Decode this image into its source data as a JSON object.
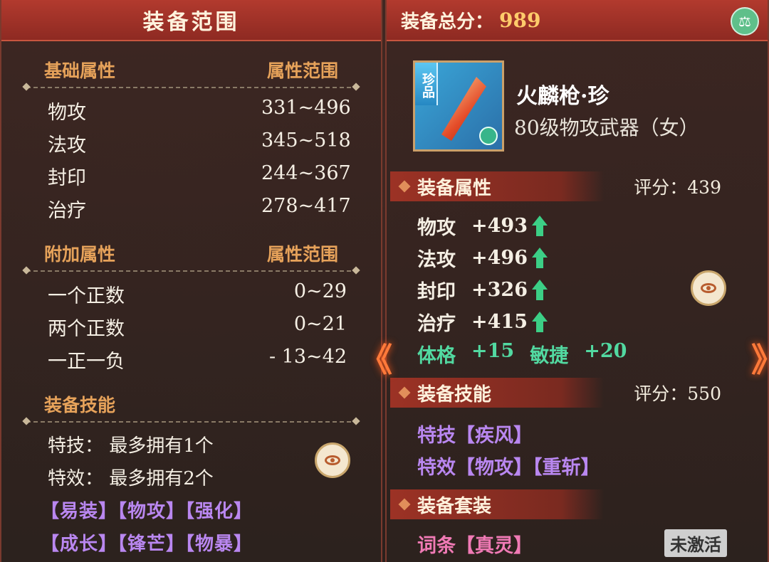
{
  "left": {
    "title": "装备范围",
    "base_section": {
      "label": "基础属性",
      "range_label": "属性范围"
    },
    "base_rows": [
      {
        "name": "物攻",
        "range": "331~496"
      },
      {
        "name": "法攻",
        "range": "345~518"
      },
      {
        "name": "封印",
        "range": "244~367"
      },
      {
        "name": "治疗",
        "range": "278~417"
      }
    ],
    "extra_section": {
      "label": "附加属性",
      "range_label": "属性范围"
    },
    "extra_rows": [
      {
        "name": "一个正数",
        "range": "0~29"
      },
      {
        "name": "两个正数",
        "range": "0~21"
      },
      {
        "name": "一正一负",
        "range": "- 13~42"
      }
    ],
    "skill_section": {
      "label": "装备技能"
    },
    "skill_lines": [
      "特技：  最多拥有1个",
      "特效：  最多拥有2个"
    ],
    "tag_lines": [
      "【易装】【物攻】【强化】",
      "【成长】【锋芒】【物暴】"
    ]
  },
  "right": {
    "total_label": "装备总分：",
    "total_score": "989",
    "item": {
      "grade": "珍品",
      "name": "火麟枪·珍",
      "subtitle": "80级物攻武器（女）"
    },
    "attr_section": {
      "title": "装备属性",
      "score": "评分：439"
    },
    "attr_rows": [
      {
        "name": "物攻",
        "value": "+493"
      },
      {
        "name": "法攻",
        "value": "+496"
      },
      {
        "name": "封印",
        "value": "+326"
      },
      {
        "name": "治疗",
        "value": "+415"
      }
    ],
    "bonus": [
      "体格",
      "+15",
      "敏捷",
      "+20"
    ],
    "skill_section": {
      "title": "装备技能",
      "score": "评分：550"
    },
    "skill_lines": [
      "特技【疾风】",
      "特效【物攻】【重斩】"
    ],
    "set_section": {
      "title": "装备套装"
    },
    "set_line": "词条【真灵】",
    "set_status": "未激活"
  },
  "nav": {
    "prev": "《",
    "next": "》"
  },
  "colors": {
    "accent": "#b23a2e",
    "gold": "#e6a25a",
    "purple": "#b987f0",
    "green": "#52d9a1"
  }
}
